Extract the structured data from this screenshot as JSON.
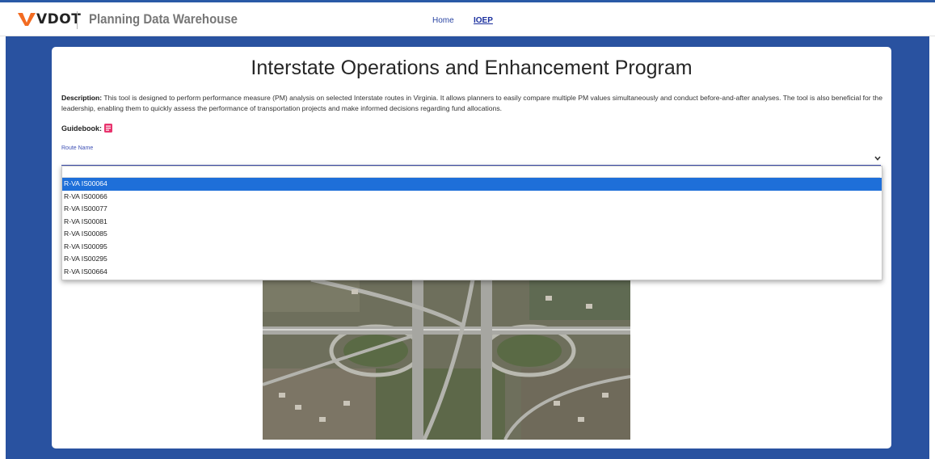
{
  "header": {
    "logo_text": "VDOT",
    "app_title": "Planning Data Warehouse",
    "nav": [
      {
        "label": "Home"
      },
      {
        "label": "IOEP"
      }
    ]
  },
  "main": {
    "title": "Interstate Operations and Enhancement Program",
    "description_label": "Description:",
    "description_text": " This tool is designed to perform performance measure (PM) analysis on selected Interstate routes in Virginia. It allows planners to easily compare multiple PM values simultaneously and conduct before-and-after analyses. The tool is also beneficial for the leadership, enabling them to quickly assess the performance of transportation projects and make informed decisions regarding fund allocations.",
    "guidebook_label": "Guidebook:",
    "route_label": "Route Name",
    "route_value": "",
    "filter_value": ""
  },
  "dropdown": {
    "options": [
      "R-VA IS00064",
      "R-VA IS00066",
      "R-VA IS00077",
      "R-VA IS00081",
      "R-VA IS00085",
      "R-VA IS00095",
      "R-VA IS00295",
      "R-VA IS00664"
    ],
    "highlighted": "R-VA IS00064"
  },
  "colors": {
    "accent": "#3f51b5",
    "page_background": "#2952a0",
    "selected_option": "#1e6fd9",
    "logo_orange": "#f26b21"
  },
  "icons": {
    "guidebook": "pdf-icon",
    "route_select": "chevron-down-icon"
  }
}
